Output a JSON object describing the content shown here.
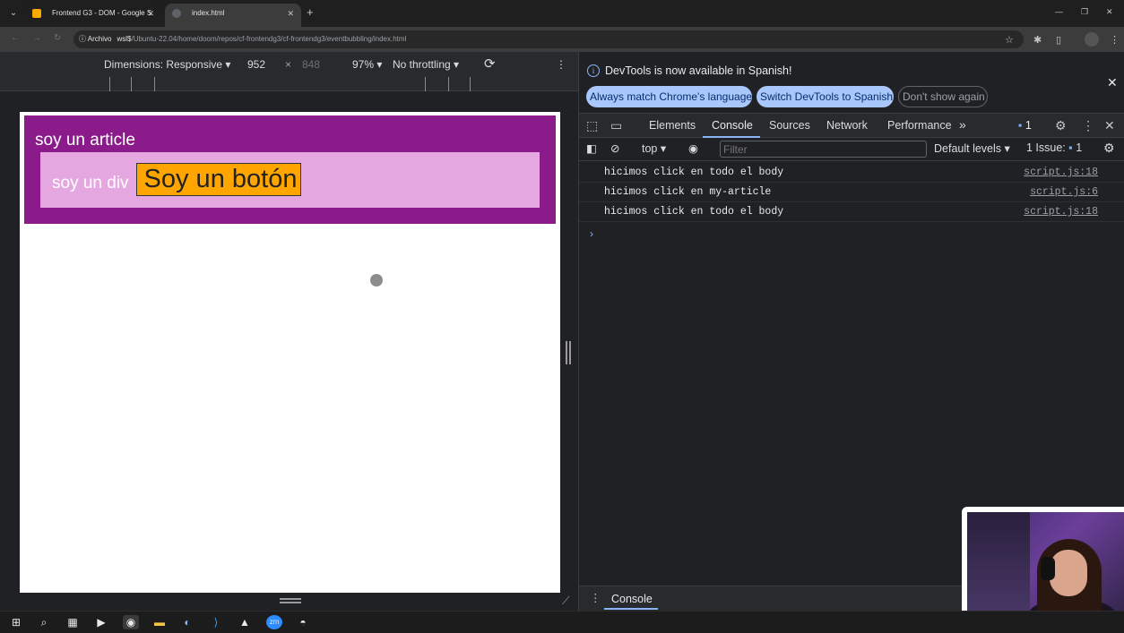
{
  "browser": {
    "tabs": [
      {
        "title": "Frontend G3 - DOM - Google S",
        "favicon_color": "#f9ab00",
        "active": false
      },
      {
        "title": "index.html",
        "favicon_color": "#5f6368",
        "active": true
      }
    ],
    "address": {
      "chip": "Archivo",
      "host": "wsl$",
      "path": "/Ubuntu-22.04/home/doom/repos/cf-frontendg3/cf-frontendg3/eventbubbling/index.html"
    }
  },
  "device_toolbar": {
    "dimensions_label": "Dimensions: Responsive ▾",
    "width": "952",
    "times": "×",
    "height": "848",
    "zoom": "97% ▾",
    "throttling": "No throttling ▾"
  },
  "page": {
    "article_label": "soy un article",
    "div_label": "soy un div",
    "button_label": "Soy un botón",
    "colors": {
      "article": "#8b1a8a",
      "div": "#e4a7e0",
      "button": "#ffa500"
    }
  },
  "devtools": {
    "infobar": {
      "message": "DevTools is now available in Spanish!",
      "always_match": "Always match Chrome's language",
      "switch": "Switch DevTools to Spanish",
      "dont_show": "Don't show again"
    },
    "tabs": [
      "Elements",
      "Console",
      "Sources",
      "Network",
      "Performance"
    ],
    "active_tab": "Console",
    "more_tabs": "»",
    "issues_badge": "1",
    "console_toolbar": {
      "context": "top",
      "filter_placeholder": "Filter",
      "levels": "Default levels ▾",
      "issues_label": "1 Issue:",
      "issues_count": "1"
    },
    "logs": [
      {
        "message": "hicimos click en todo el body",
        "source": "script.js:18"
      },
      {
        "message": "hicimos click en my-article",
        "source": "script.js:6"
      },
      {
        "message": "hicimos click en todo el body",
        "source": "script.js:18"
      }
    ],
    "prompt": "›",
    "drawer_tab": "Console"
  },
  "taskbar": {
    "icons": [
      "windows-start",
      "search",
      "task-view",
      "media-player",
      "chrome",
      "file-explorer",
      "steam",
      "vscode",
      "linux-terminal",
      "zoom",
      "paint"
    ]
  }
}
